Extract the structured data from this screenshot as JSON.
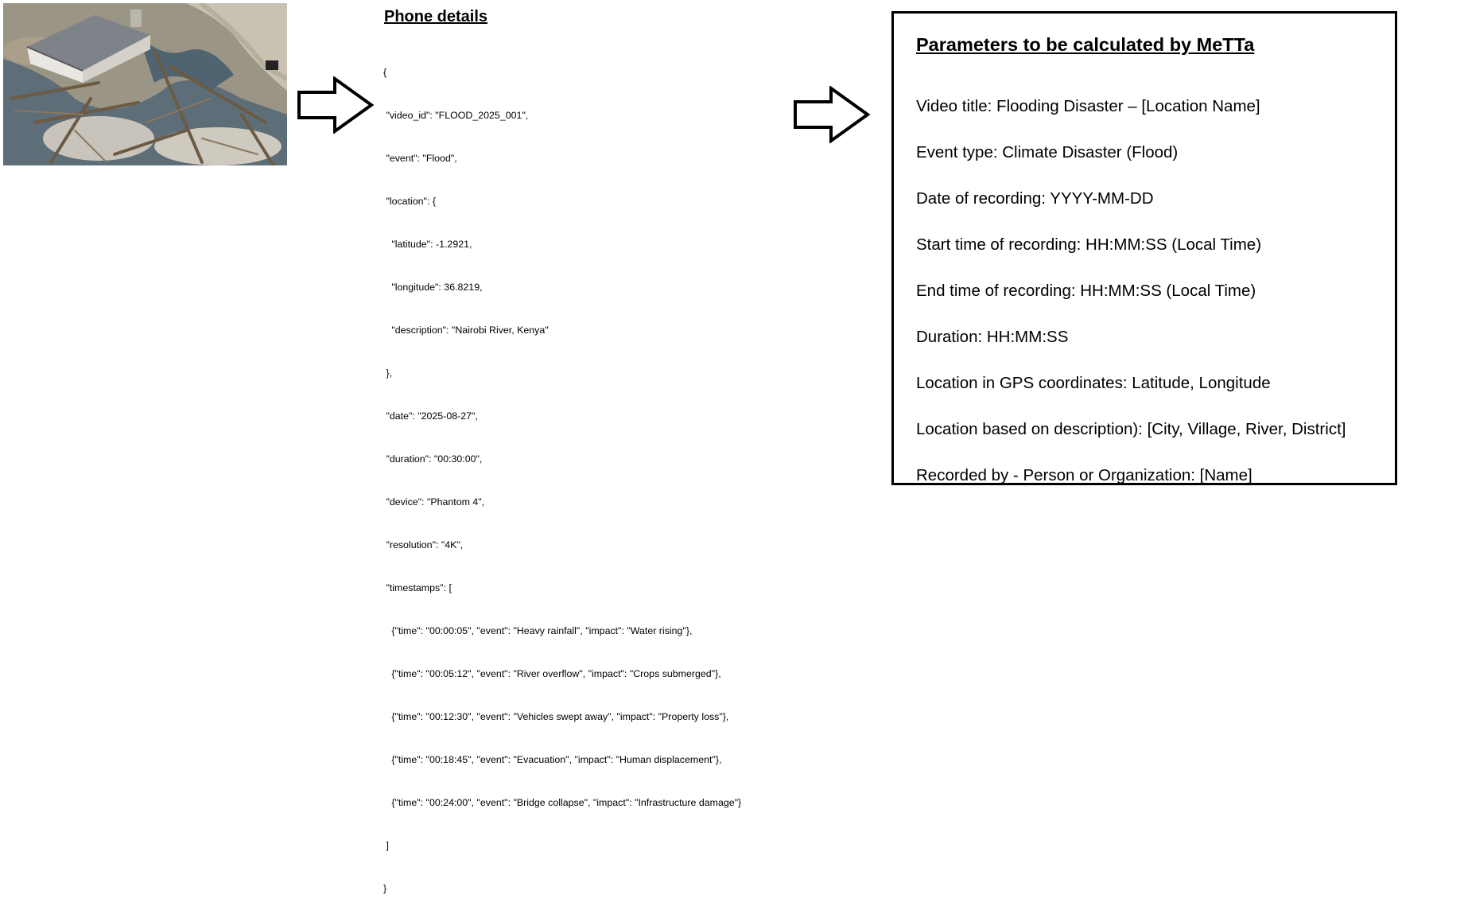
{
  "phone_details": {
    "title": "Phone details",
    "json_lines": [
      "{",
      " \"video_id\": \"FLOOD_2025_001\",",
      " \"event\": \"Flood\",",
      " \"location\": {",
      "   \"latitude\": -1.2921,",
      "   \"longitude\": 36.8219,",
      "   \"description\": \"Nairobi River, Kenya\"",
      " },",
      " \"date\": \"2025-08-27\",",
      " \"duration\": \"00:30:00\",",
      " \"device\": \"Phantom 4\",",
      " \"resolution\": \"4K\",",
      " \"timestamps\": [",
      "   {\"time\": \"00:00:05\", \"event\": \"Heavy rainfall\", \"impact\": \"Water rising\"},",
      "   {\"time\": \"00:05:12\", \"event\": \"River overflow\", \"impact\": \"Crops submerged\"},",
      "   {\"time\": \"00:12:30\", \"event\": \"Vehicles swept away\", \"impact\": \"Property loss\"},",
      "   {\"time\": \"00:18:45\", \"event\": \"Evacuation\", \"impact\": \"Human displacement\"},",
      "   {\"time\": \"00:24:00\", \"event\": \"Bridge collapse\", \"impact\": \"Infrastructure damage\"}",
      " ]",
      "}"
    ]
  },
  "parameters_panel": {
    "title": "Parameters to be calculated by MeTTa",
    "items": [
      "Video title: Flooding Disaster – [Location Name]",
      "Event type: Climate Disaster (Flood)",
      "Date of recording: YYYY-MM-DD",
      "Start time of recording: HH:MM:SS (Local Time)",
      "End time of recording: HH:MM:SS (Local Time)",
      "Duration: HH:MM:SS",
      "Location in GPS coordinates: Latitude, Longitude",
      "Location based on description): [City, Village, River, District]",
      "Recorded by - Person or Organization: [Name]"
    ]
  },
  "icons": [
    "flood-photo",
    "right-arrow-icon",
    "right-arrow-icon"
  ],
  "colors": {
    "text": "#000000",
    "background": "#ffffff",
    "border": "#000000"
  }
}
